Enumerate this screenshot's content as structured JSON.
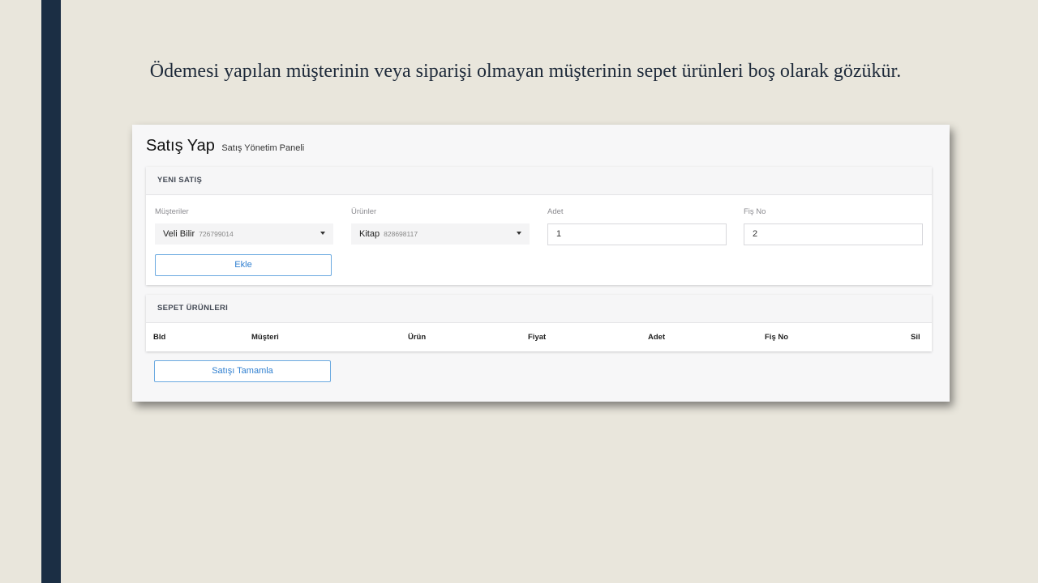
{
  "slide": {
    "caption": "Ödemesi yapılan müşterinin veya siparişi olmayan müşterinin sepet ürünleri boş olarak gözükür."
  },
  "panel": {
    "title": "Satış Yap",
    "subtitle": "Satış Yönetim Paneli"
  },
  "new_sale": {
    "header": "YENI SATIŞ",
    "customers": {
      "label": "Müşteriler",
      "selected_name": "Veli Bilir",
      "selected_code": "726799014"
    },
    "products": {
      "label": "Ürünler",
      "selected_name": "Kitap",
      "selected_code": "828698117"
    },
    "quantity": {
      "label": "Adet",
      "value": "1"
    },
    "receipt": {
      "label": "Fiş No",
      "value": "2"
    },
    "add_button": "Ekle"
  },
  "cart": {
    "header": "SEPET ÜRÜNLERI",
    "columns": [
      "BId",
      "Müşteri",
      "Ürün",
      "Fiyat",
      "Adet",
      "Fiş No",
      "Sil"
    ],
    "rows": [],
    "complete_button": "Satışı Tamamla"
  }
}
